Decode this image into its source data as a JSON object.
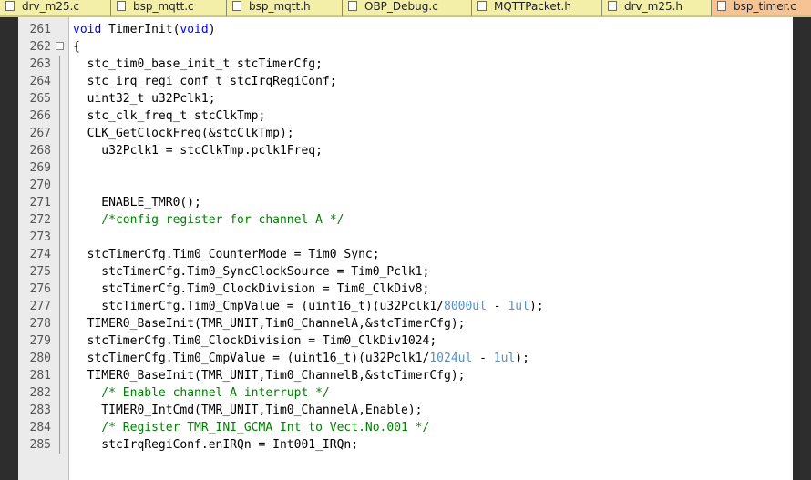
{
  "tabs": [
    {
      "label": "drv_m25.c"
    },
    {
      "label": "bsp_mqtt.c"
    },
    {
      "label": "bsp_mqtt.h"
    },
    {
      "label": "OBP_Debug.c"
    },
    {
      "label": "MQTTPacket.h"
    },
    {
      "label": "drv_m25.h"
    },
    {
      "label": "bsp_timer.c"
    }
  ],
  "editor": {
    "lines": [
      {
        "num": "261",
        "parts": [
          {
            "t": "void",
            "c": "kw"
          },
          {
            "t": " TimerInit(",
            "c": ""
          },
          {
            "t": "void",
            "c": "kw"
          },
          {
            "t": ")",
            "c": ""
          }
        ]
      },
      {
        "num": "262",
        "fold": true,
        "parts": [
          {
            "t": "{",
            "c": ""
          }
        ]
      },
      {
        "num": "263",
        "parts": [
          {
            "t": "  stc_tim0_base_init_t stcTimerCfg;",
            "c": ""
          }
        ]
      },
      {
        "num": "264",
        "parts": [
          {
            "t": "  stc_irq_regi_conf_t stcIrqRegiConf;",
            "c": ""
          }
        ]
      },
      {
        "num": "265",
        "parts": [
          {
            "t": "  uint32_t u32Pclk1;",
            "c": ""
          }
        ]
      },
      {
        "num": "266",
        "parts": [
          {
            "t": "  stc_clk_freq_t stcClkTmp;",
            "c": ""
          }
        ]
      },
      {
        "num": "267",
        "parts": [
          {
            "t": "  CLK_GetClockFreq(&stcClkTmp);",
            "c": ""
          }
        ]
      },
      {
        "num": "268",
        "parts": [
          {
            "t": "    u32Pclk1 = stcClkTmp.pclk1Freq;",
            "c": ""
          }
        ]
      },
      {
        "num": "269",
        "parts": []
      },
      {
        "num": "270",
        "parts": []
      },
      {
        "num": "271",
        "parts": [
          {
            "t": "    ENABLE_TMR0();",
            "c": ""
          }
        ]
      },
      {
        "num": "272",
        "parts": [
          {
            "t": "    /*config register for channel A */",
            "c": "comment"
          }
        ]
      },
      {
        "num": "273",
        "parts": []
      },
      {
        "num": "274",
        "parts": [
          {
            "t": "  stcTimerCfg.Tim0_CounterMode = Tim0_Sync;",
            "c": ""
          }
        ]
      },
      {
        "num": "275",
        "parts": [
          {
            "t": "    stcTimerCfg.Tim0_SyncClockSource = Tim0_Pclk1;",
            "c": ""
          }
        ]
      },
      {
        "num": "276",
        "parts": [
          {
            "t": "    stcTimerCfg.Tim0_ClockDivision = Tim0_ClkDiv8;",
            "c": ""
          }
        ]
      },
      {
        "num": "277",
        "parts": [
          {
            "t": "    stcTimerCfg.Tim0_CmpValue = (uint16_t)(u32Pclk1/",
            "c": ""
          },
          {
            "t": "8000ul",
            "c": "num"
          },
          {
            "t": " - ",
            "c": ""
          },
          {
            "t": "1ul",
            "c": "num"
          },
          {
            "t": ");",
            "c": ""
          }
        ]
      },
      {
        "num": "278",
        "parts": [
          {
            "t": "  TIMER0_BaseInit(TMR_UNIT,Tim0_ChannelA,&stcTimerCfg);",
            "c": ""
          }
        ]
      },
      {
        "num": "279",
        "parts": [
          {
            "t": "  stcTimerCfg.Tim0_ClockDivision = Tim0_ClkDiv1024;",
            "c": ""
          }
        ]
      },
      {
        "num": "280",
        "parts": [
          {
            "t": "  stcTimerCfg.Tim0_CmpValue = (uint16_t)(u32Pclk1/",
            "c": ""
          },
          {
            "t": "1024ul",
            "c": "num"
          },
          {
            "t": " - ",
            "c": ""
          },
          {
            "t": "1ul",
            "c": "num"
          },
          {
            "t": ");",
            "c": ""
          }
        ]
      },
      {
        "num": "281",
        "parts": [
          {
            "t": "  TIMER0_BaseInit(TMR_UNIT,Tim0_ChannelB,&stcTimerCfg);",
            "c": ""
          }
        ]
      },
      {
        "num": "282",
        "parts": [
          {
            "t": "    /* Enable channel A interrupt */",
            "c": "comment"
          }
        ]
      },
      {
        "num": "283",
        "parts": [
          {
            "t": "    TIMER0_IntCmd(TMR_UNIT,Tim0_ChannelA,Enable);",
            "c": ""
          }
        ]
      },
      {
        "num": "284",
        "parts": [
          {
            "t": "    /* Register TMR_INI_GCMA Int to Vect.No.001 */",
            "c": "comment"
          }
        ]
      },
      {
        "num": "285",
        "parts": [
          {
            "t": "    stcIrqRegiConf.enIRQn = Int001_IRQn;",
            "c": ""
          }
        ]
      }
    ]
  },
  "colors": {
    "keyword": "#0000ff",
    "comment": "#008000",
    "number": "#5a8fbf",
    "tab_background": "#f3eea8",
    "active_tab_background": "#f6c394"
  }
}
